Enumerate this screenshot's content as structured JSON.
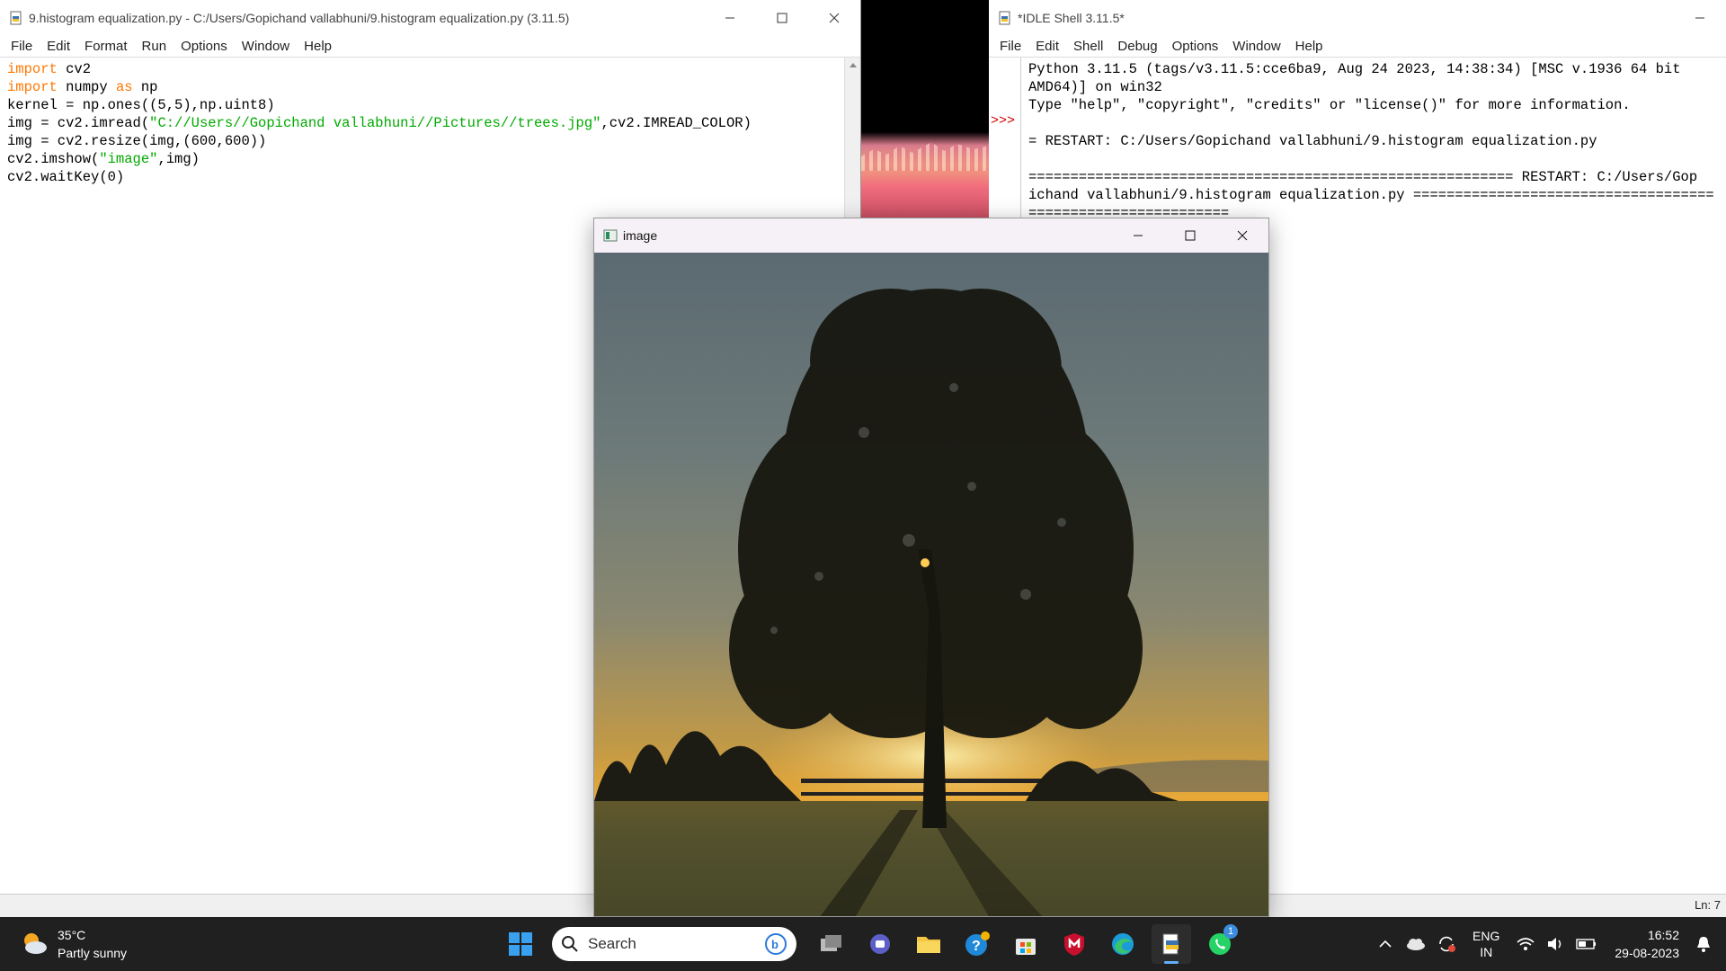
{
  "editor": {
    "title": "9.histogram equalization.py - C:/Users/Gopichand vallabhuni/9.histogram equalization.py (3.11.5)",
    "menu": [
      "File",
      "Edit",
      "Format",
      "Run",
      "Options",
      "Window",
      "Help"
    ],
    "code": [
      {
        "kw": "import",
        "rest": " cv2"
      },
      {
        "kw": "import",
        "rest": " numpy ",
        "kw2": "as",
        "rest2": " np"
      },
      {
        "plain": "kernel = np.ones((5,5),np.uint8)"
      },
      {
        "pre": "img = cv2.imread(",
        "str": "\"C://Users//Gopichand vallabhuni//Pictures//trees.jpg\"",
        "post": ",cv2.IMREAD_COLOR)"
      },
      {
        "plain": "img = cv2.resize(img,(600,600))"
      },
      {
        "pre": "cv2.imshow(",
        "str": "\"image\"",
        "post": ",img)"
      },
      {
        "plain": "cv2.waitKey(0)"
      }
    ]
  },
  "shell": {
    "title": "*IDLE Shell 3.11.5*",
    "menu": [
      "File",
      "Edit",
      "Shell",
      "Debug",
      "Options",
      "Window",
      "Help"
    ],
    "prompt": ">>>",
    "lines": [
      "Python 3.11.5 (tags/v3.11.5:cce6ba9, Aug 24 2023, 14:38:34) [MSC v.1936 64 bit",
      "AMD64)] on win32",
      "Type \"help\", \"copyright\", \"credits\" or \"license()\" for more information.",
      "",
      "= RESTART: C:/Users/Gopichand vallabhuni/9.histogram equalization.py",
      "",
      "========================================================== RESTART: C:/Users/Gop",
      "ichand vallabhuni/9.histogram equalization.py ====================================",
      "========================"
    ],
    "status": "Ln: 7"
  },
  "image_window": {
    "title": "image"
  },
  "taskbar": {
    "weather_temp": "35°C",
    "weather_desc": "Partly sunny",
    "search_label": "Search",
    "whatsapp_badge": "1",
    "lang_top": "ENG",
    "lang_bottom": "IN",
    "time": "16:52",
    "date": "29-08-2023"
  }
}
